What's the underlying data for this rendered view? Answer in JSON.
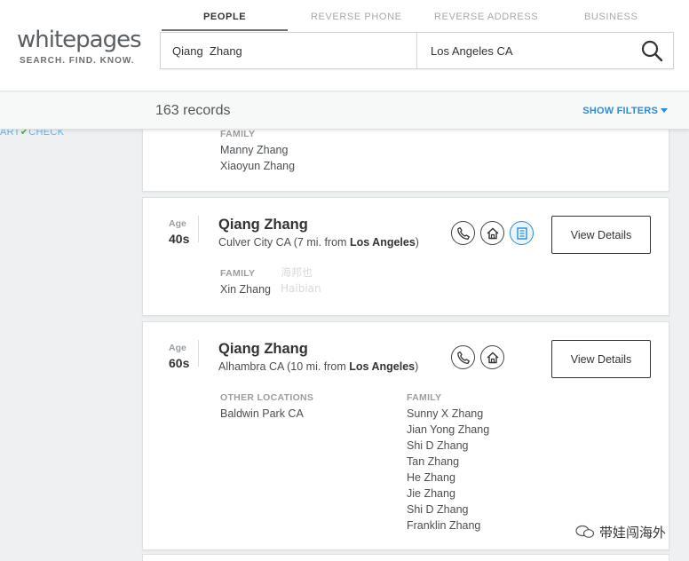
{
  "header": {
    "logo_text": "whitepages",
    "logo_tagline": "SEARCH. FIND. KNOW.",
    "tabs": [
      {
        "label": "PEOPLE",
        "active": true
      },
      {
        "label": "REVERSE PHONE",
        "active": false
      },
      {
        "label": "REVERSE ADDRESS",
        "active": false
      },
      {
        "label": "BUSINESS",
        "active": false
      }
    ],
    "search": {
      "name_value": "Qiang  Zhang",
      "location_value": "Los Angeles CA"
    }
  },
  "results": {
    "count_text": "163 records",
    "filters_label": "SHOW FILTERS"
  },
  "sidebar": {
    "smart_check_prefix": "ART",
    "smart_check_suffix": "CHECK"
  },
  "cards": [
    {
      "family_label": "FAMILY",
      "family": [
        "Manny Zhang",
        "Xiaoyun Zhang"
      ]
    },
    {
      "age_label": "Age",
      "age": "40s",
      "name": "Qiang Zhang",
      "location_prefix": "Culver City CA (7 mi. from ",
      "location_city": "Los Angeles",
      "location_suffix": ")",
      "family_label": "FAMILY",
      "family": [
        "Xin Zhang"
      ],
      "details_label": "View Details"
    },
    {
      "age_label": "Age",
      "age": "60s",
      "name": "Qiang Zhang",
      "location_prefix": "Alhambra CA (10 mi. from ",
      "location_city": "Los Angeles",
      "location_suffix": ")",
      "other_locations_label": "OTHER LOCATIONS",
      "other_locations": [
        "Baldwin Park CA"
      ],
      "family_label": "FAMILY",
      "family": [
        "Sunny X Zhang",
        "Jian Yong Zhang",
        "Shi D Zhang",
        "Tan Zhang",
        "He Zhang",
        "Jie Zhang",
        "Shi D Zhang",
        "Franklin Zhang"
      ],
      "details_label": "View Details"
    }
  ],
  "watermark": {
    "account": "带娃闯海外",
    "ghost_cn": "海邦也",
    "ghost_en": "Haibian"
  },
  "colors": {
    "accent": "#2a8ed6",
    "check": "#4caf50"
  }
}
